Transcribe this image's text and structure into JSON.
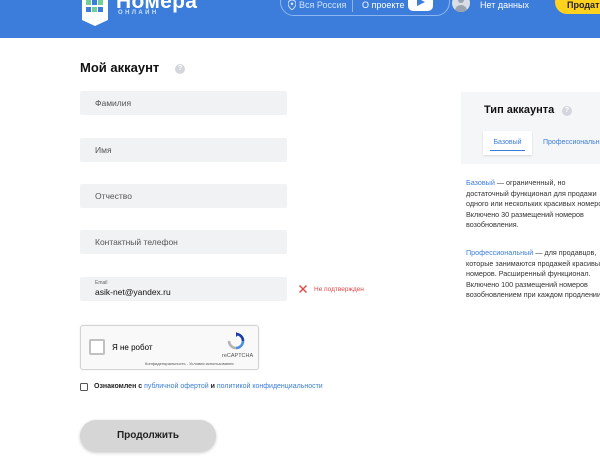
{
  "header": {
    "logo_text": "Номера",
    "logo_sub": "ОНЛАЙН",
    "location": "Вся Россия",
    "about_label": "О проекте",
    "user_label": "Нет данных",
    "sell_button": "Продать"
  },
  "form": {
    "title": "Мой аккаунт",
    "help_glyph": "?",
    "last_name_placeholder": "Фамилия",
    "first_name_placeholder": "Имя",
    "middle_name_placeholder": "Отчество",
    "phone_placeholder": "Контактный телефон",
    "email_label": "Email",
    "email_value": "asik-net@yandex.ru",
    "email_status": "Не подтвержден",
    "captcha_label": "Я не робот",
    "captcha_brand": "reCAPTCHA",
    "captcha_terms": "Конфиденциальность - Условия использования",
    "agree_prefix": "Ознакомлен с",
    "agree_offer_link": "публичной офертой",
    "agree_and": "и",
    "agree_privacy_link": "политикой конфиденциальности",
    "continue_button": "Продолжить"
  },
  "account_type": {
    "title": "Тип аккаунта",
    "tabs": [
      "Базовый",
      "Профессиональный"
    ],
    "basic_name": "Базовый",
    "basic_line1": " — ограниченный, но",
    "basic_line2": "достаточный функционал для продажи",
    "basic_line3": "одного или нескольких красивых номеров.",
    "basic_line4": "Включено 30 размещений номеров",
    "basic_line5": "возобновления.",
    "pro_name": "Профессиональный",
    "pro_line1": " — для продавцов,",
    "pro_line2": "которые занимаются продажей красивых",
    "pro_line3": "номеров. Расширенный функционал.",
    "pro_line4": "Включено 100 размещений номеров",
    "pro_line5": "возобновлением при каждом продлении."
  },
  "colors": {
    "brand_blue": "#3c7ddb",
    "accent_yellow": "#ffd21e",
    "error_red": "#e04848"
  }
}
